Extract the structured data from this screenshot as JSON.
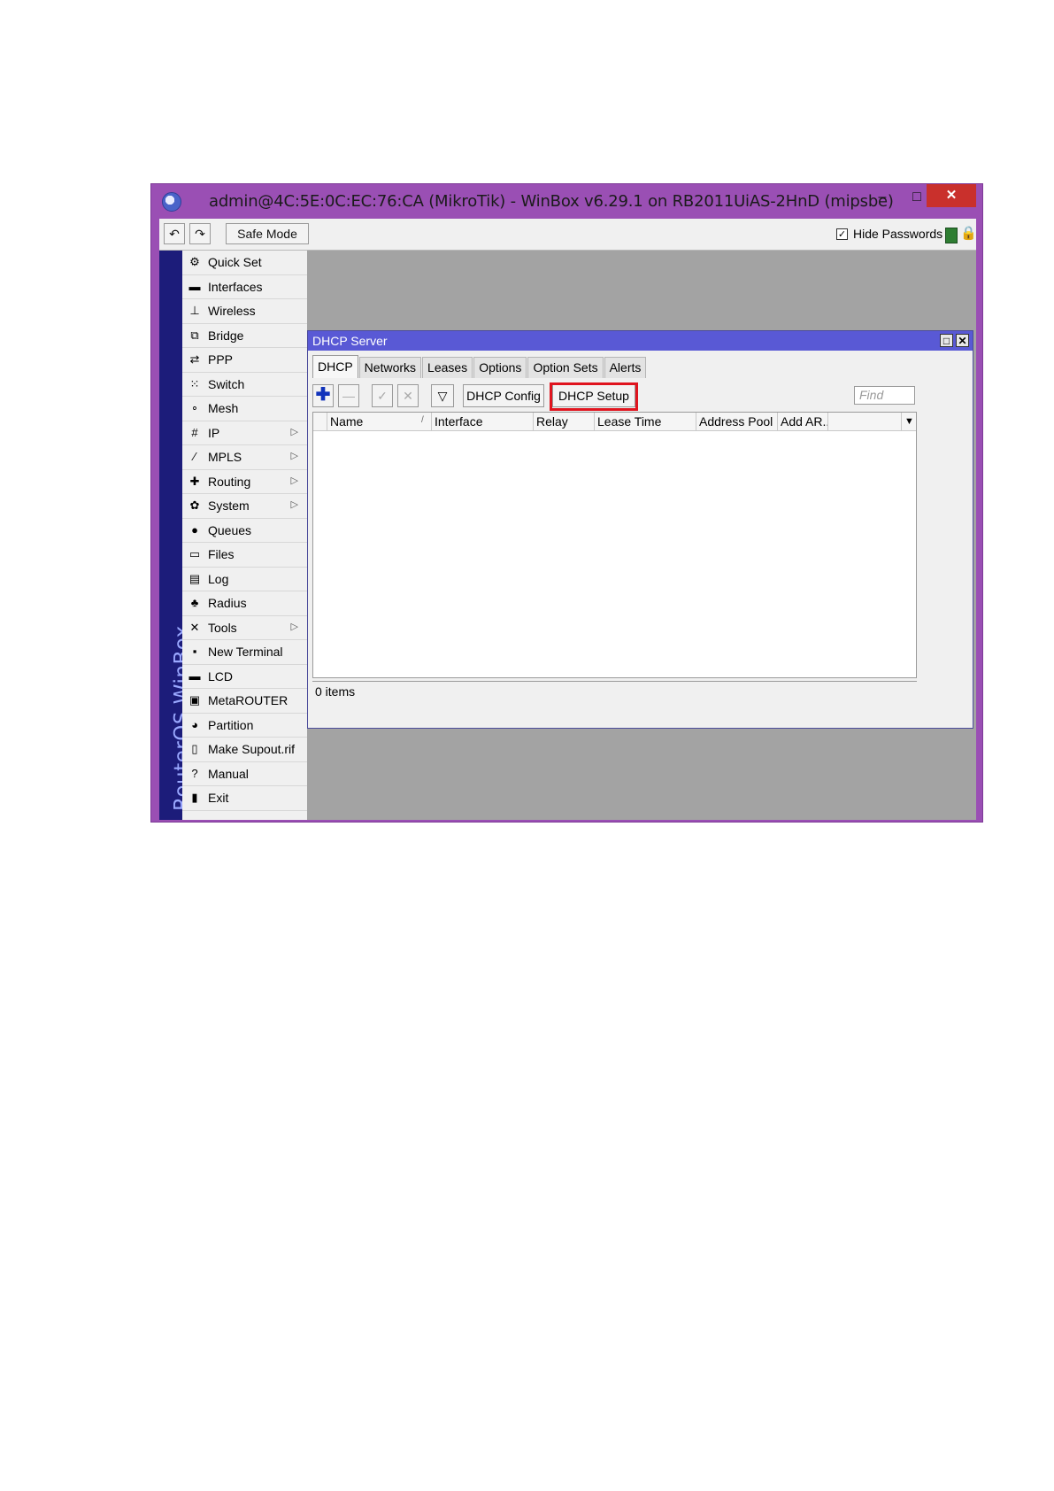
{
  "window": {
    "title": "admin@4C:5E:0C:EC:76:CA (MikroTik) - WinBox v6.29.1 on RB2011UiAS-2HnD (mipsbe)",
    "minimize_glyph": "–",
    "maximize_glyph": "□",
    "close_glyph": "✕"
  },
  "toolbar": {
    "undo_glyph": "↶",
    "redo_glyph": "↷",
    "safe_mode_label": "Safe Mode",
    "hide_passwords_label": "Hide Passwords",
    "hide_passwords_checked": true,
    "lock_glyph": "🔒"
  },
  "sidebar": {
    "brand": "RouterOS WinBox",
    "items": [
      {
        "label": "Quick Set",
        "icon": "quick-set-icon",
        "glyph": "⚙",
        "submenu": false
      },
      {
        "label": "Interfaces",
        "icon": "interfaces-icon",
        "glyph": "▬",
        "submenu": false
      },
      {
        "label": "Wireless",
        "icon": "wireless-icon",
        "glyph": "⊥",
        "submenu": false
      },
      {
        "label": "Bridge",
        "icon": "bridge-icon",
        "glyph": "⧉",
        "submenu": false
      },
      {
        "label": "PPP",
        "icon": "ppp-icon",
        "glyph": "⇄",
        "submenu": false
      },
      {
        "label": "Switch",
        "icon": "switch-icon",
        "glyph": "⁙",
        "submenu": false
      },
      {
        "label": "Mesh",
        "icon": "mesh-icon",
        "glyph": "∘",
        "submenu": false
      },
      {
        "label": "IP",
        "icon": "ip-icon",
        "glyph": "#",
        "submenu": true
      },
      {
        "label": "MPLS",
        "icon": "mpls-icon",
        "glyph": "⁄",
        "submenu": true
      },
      {
        "label": "Routing",
        "icon": "routing-icon",
        "glyph": "✚",
        "submenu": true
      },
      {
        "label": "System",
        "icon": "system-icon",
        "glyph": "✿",
        "submenu": true
      },
      {
        "label": "Queues",
        "icon": "queues-icon",
        "glyph": "●",
        "submenu": false
      },
      {
        "label": "Files",
        "icon": "files-icon",
        "glyph": "▭",
        "submenu": false
      },
      {
        "label": "Log",
        "icon": "log-icon",
        "glyph": "▤",
        "submenu": false
      },
      {
        "label": "Radius",
        "icon": "radius-icon",
        "glyph": "♣",
        "submenu": false
      },
      {
        "label": "Tools",
        "icon": "tools-icon",
        "glyph": "✕",
        "submenu": true
      },
      {
        "label": "New Terminal",
        "icon": "terminal-icon",
        "glyph": "▪",
        "submenu": false
      },
      {
        "label": "LCD",
        "icon": "lcd-icon",
        "glyph": "▬",
        "submenu": false
      },
      {
        "label": "MetaROUTER",
        "icon": "metarouter-icon",
        "glyph": "▣",
        "submenu": false
      },
      {
        "label": "Partition",
        "icon": "partition-icon",
        "glyph": "◕",
        "submenu": false
      },
      {
        "label": "Make Supout.rif",
        "icon": "supout-icon",
        "glyph": "▯",
        "submenu": false
      },
      {
        "label": "Manual",
        "icon": "manual-icon",
        "glyph": "?",
        "submenu": false
      },
      {
        "label": "Exit",
        "icon": "exit-icon",
        "glyph": "▮",
        "submenu": false
      }
    ],
    "submenu_arrow": "▷"
  },
  "dhcp_window": {
    "title": "DHCP Server",
    "tabs": [
      "DHCP",
      "Networks",
      "Leases",
      "Options",
      "Option Sets",
      "Alerts"
    ],
    "active_tab": "DHCP",
    "buttons": {
      "add_glyph": "✚",
      "remove_glyph": "—",
      "enable_glyph": "✓",
      "disable_glyph": "✕",
      "filter_glyph": "▽",
      "config_label": "DHCP Config",
      "setup_label": "DHCP Setup"
    },
    "find_placeholder": "Find",
    "columns": [
      "Name",
      "Interface",
      "Relay",
      "Lease Time",
      "Address Pool",
      "Add AR..."
    ],
    "sort_glyph": "/",
    "dropdown_glyph": "▼",
    "rows": [],
    "status": "0 items",
    "highlight_color": "#e0141e"
  },
  "colors": {
    "window_frame": "#9a4fb4",
    "sidebar_strip": "#1c1c7a",
    "subwindow_title": "#5959d5",
    "close_button": "#c9302c"
  }
}
